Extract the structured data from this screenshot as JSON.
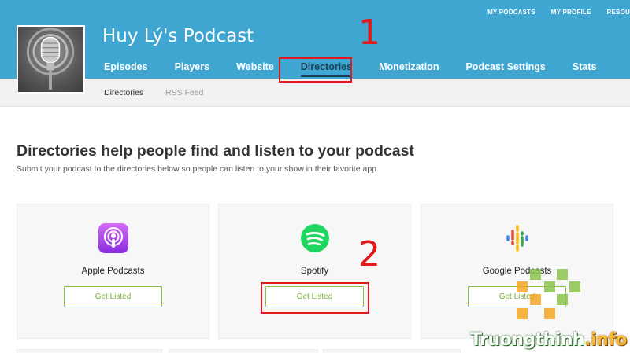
{
  "top_links": [
    "MY PODCASTS",
    "MY PROFILE",
    "RESOU"
  ],
  "podcast_title": "Huy Lý's Podcast",
  "main_nav": [
    "Episodes",
    "Players",
    "Website",
    "Directories",
    "Monetization",
    "Podcast Settings",
    "Stats"
  ],
  "active_tab": "Directories",
  "sub_nav": [
    "Directories",
    "RSS Feed"
  ],
  "heading": "Directories help people find and listen to your podcast",
  "subheading": "Submit your podcast to the directories below so people can listen to your show in their favorite app.",
  "cards": [
    {
      "name": "Apple Podcasts",
      "button": "Get Listed",
      "icon": "apple-podcasts-icon"
    },
    {
      "name": "Spotify",
      "button": "Get Listed",
      "icon": "spotify-icon"
    },
    {
      "name": "Google Podcasts",
      "button": "Get Listed",
      "icon": "google-podcasts-icon"
    }
  ],
  "annotations": [
    "1",
    "2"
  ],
  "watermark": {
    "main": "Truongthinh",
    "suffix": ".info"
  },
  "colors": {
    "header": "#3fa6d1",
    "active_tab": "#1d3e57",
    "button_green": "#8ac249",
    "annotation_red": "#e11b1b"
  }
}
